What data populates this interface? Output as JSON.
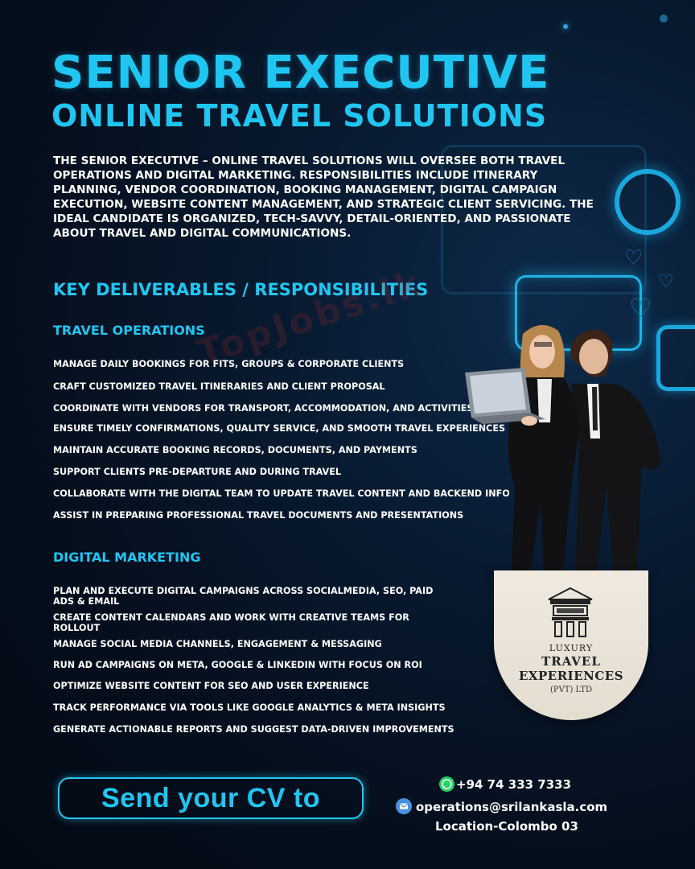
{
  "header": {
    "title_line1": "SENIOR EXECUTIVE",
    "title_line2": "ONLINE TRAVEL SOLUTIONS"
  },
  "intro": "THE SENIOR EXECUTIVE – ONLINE TRAVEL SOLUTIONS WILL OVERSEE BOTH TRAVEL OPERATIONS AND DIGITAL MARKETING. RESPONSIBILITIES INCLUDE ITINERARY PLANNING, VENDOR COORDINATION, BOOKING MANAGEMENT, DIGITAL CAMPAIGN EXECUTION, WEBSITE CONTENT MANAGEMENT, AND STRATEGIC CLIENT SERVICING. THE IDEAL CANDIDATE IS ORGANIZED, TECH-SAVVY, DETAIL-ORIENTED, AND PASSIONATE ABOUT TRAVEL AND DIGITAL COMMUNICATIONS.",
  "responsibilities_heading": "KEY DELIVERABLES / RESPONSIBILITIES",
  "travel_operations": {
    "heading": "TRAVEL OPERATIONS",
    "items": [
      "MANAGE DAILY BOOKINGS FOR FITS, GROUPS & CORPORATE CLIENTS",
      "CRAFT CUSTOMIZED TRAVEL ITINERARIES AND CLIENT PROPOSAL",
      "COORDINATE WITH VENDORS FOR TRANSPORT, ACCOMMODATION, AND ACTIVITIES",
      "ENSURE TIMELY CONFIRMATIONS, QUALITY SERVICE, AND SMOOTH TRAVEL EXPERIENCES",
      "MAINTAIN ACCURATE BOOKING RECORDS, DOCUMENTS, AND PAYMENTS",
      "SUPPORT CLIENTS PRE-DEPARTURE AND DURING TRAVEL",
      "COLLABORATE WITH THE DIGITAL TEAM TO UPDATE TRAVEL CONTENT AND BACKEND INFO",
      "ASSIST IN PREPARING PROFESSIONAL TRAVEL DOCUMENTS AND PRESENTATIONS"
    ]
  },
  "digital_marketing": {
    "heading": "DIGITAL MARKETING",
    "items": [
      "PLAN AND EXECUTE DIGITAL CAMPAIGNS ACROSS SOCIALMEDIA, SEO, PAID ADS & EMAIL",
      "CREATE CONTENT CALENDARS AND WORK WITH CREATIVE TEAMS FOR ROLLOUT",
      "MANAGE SOCIAL MEDIA CHANNELS, ENGAGEMENT & MESSAGING",
      "RUN AD CAMPAIGNS ON META, GOOGLE & LINKEDIN WITH FOCUS ON ROI",
      "OPTIMIZE WEBSITE CONTENT FOR SEO AND USER EXPERIENCE",
      "TRACK PERFORMANCE VIA TOOLS LIKE GOOGLE ANALYTICS & META INSIGHTS",
      "GENERATE ACTIONABLE REPORTS AND SUGGEST DATA-DRIVEN IMPROVEMENTS"
    ]
  },
  "watermark": "TopJobs.lk",
  "logo": {
    "line1": "LUXURY",
    "line2": "TRAVEL",
    "line3": "EXPERIENCES",
    "line4": "(PVT) LTD"
  },
  "cta": {
    "label": "Send your CV to"
  },
  "contact": {
    "phone": "+94 74 333 7333",
    "email": "operations@srilankasla.com",
    "location": "Location-Colombo 03"
  },
  "icons": [
    "whatsapp-icon",
    "email-icon",
    "chat-bubble-icon",
    "heart-icon",
    "camera-icon"
  ],
  "colors": {
    "accent": "#20c6f2",
    "background": "#050e1c"
  }
}
